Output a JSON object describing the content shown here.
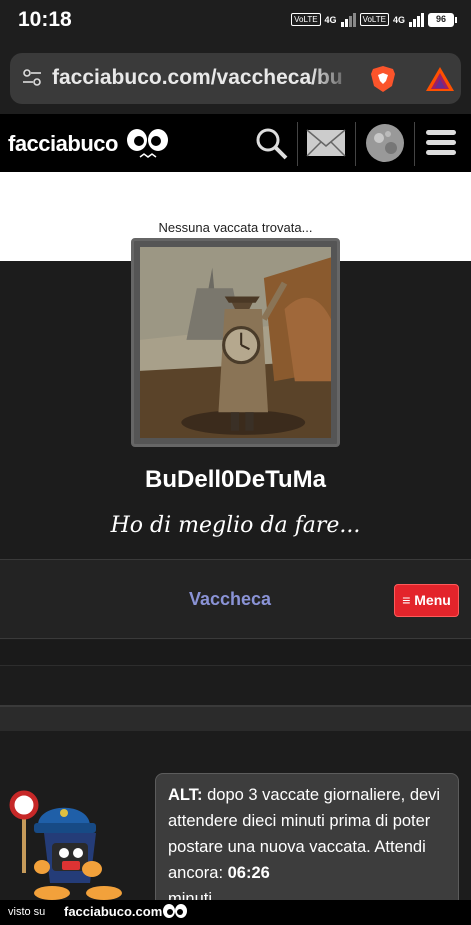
{
  "status_bar": {
    "time": "10:18",
    "volte1": "VoLTE",
    "net1": "4G",
    "volte2": "VoLTE",
    "net2": "4G",
    "battery": "96"
  },
  "browser": {
    "url": "facciabuco.com/vaccheca/bu"
  },
  "site": {
    "logo": "facciabuco",
    "notice": "Nessuna vaccata trovata..."
  },
  "profile": {
    "username": "BuDell0DeTuMa",
    "motto": "Ho di meglio da fare..."
  },
  "nav": {
    "brand": "Vaccheca",
    "menu_label": "≡ Menu"
  },
  "alert": {
    "prefix": "ALT:",
    "text": " dopo 3 vaccate giornaliere, devi attendere dieci minuti prima di poter postare una nuova vaccata. Attendi ancora: ",
    "countdown": "06:26",
    "suffix": "minuti"
  },
  "footer": {
    "visto": "visto su",
    "site": "facciabuco.com"
  },
  "colors": {
    "menu_red": "#e3242b",
    "brand_blue": "#8a93d6"
  }
}
